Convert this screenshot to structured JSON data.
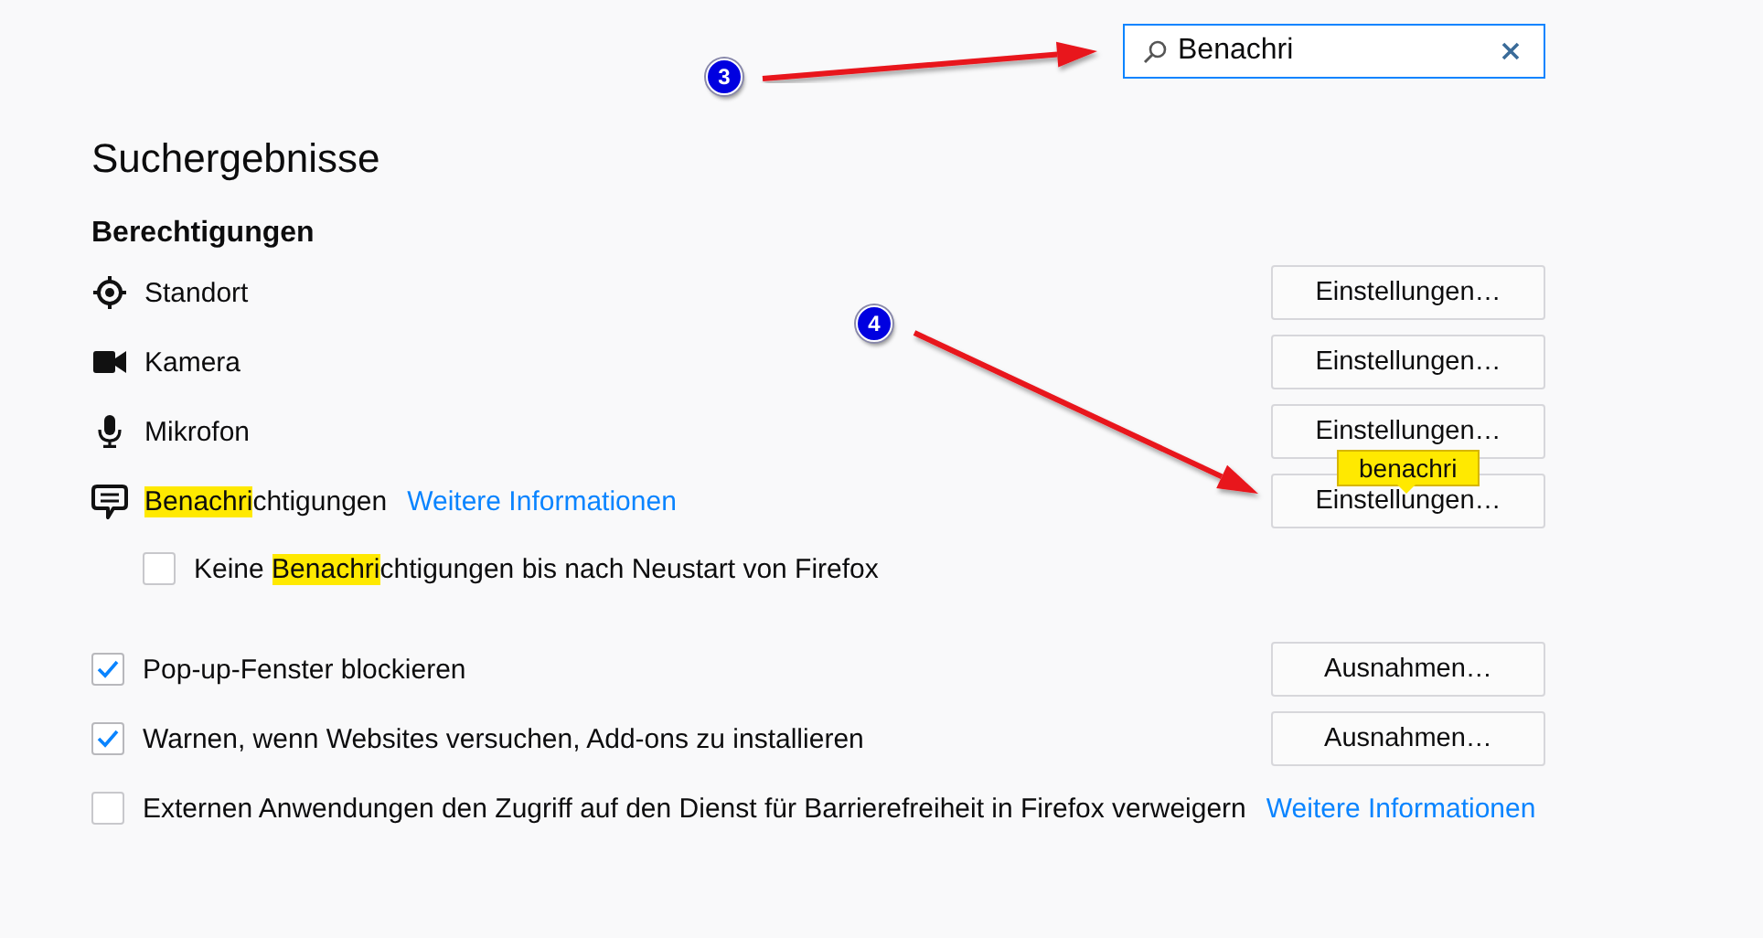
{
  "search": {
    "value": "Benachri"
  },
  "heading": "Suchergebnisse",
  "section": "Berechtigungen",
  "permissions": [
    {
      "kind": "location",
      "label_parts": [
        {
          "text": "Standort",
          "highlighted": false
        }
      ],
      "button": "Einstellungen…"
    },
    {
      "kind": "camera",
      "label_parts": [
        {
          "text": "Kamera",
          "highlighted": false
        }
      ],
      "button": "Einstellungen…"
    },
    {
      "kind": "microphone",
      "label_parts": [
        {
          "text": "Mikrofon",
          "highlighted": false
        }
      ],
      "button": "Einstellungen…"
    },
    {
      "kind": "notifications",
      "label_parts": [
        {
          "text": "Benachri",
          "highlighted": true
        },
        {
          "text": "chtigungen",
          "highlighted": false
        }
      ],
      "link": "Weitere Informationen",
      "button": "Einstellungen…",
      "tooltip": "benachri",
      "option": {
        "checked": false,
        "label_parts": [
          {
            "text": "Keine ",
            "highlighted": false
          },
          {
            "text": "Benachri",
            "highlighted": true
          },
          {
            "text": "chtigungen bis nach Neustart von Firefox",
            "highlighted": false
          }
        ]
      }
    }
  ],
  "checkboxes": [
    {
      "label": "Pop-up-Fenster blockieren",
      "checked": true,
      "button": "Ausnahmen…"
    },
    {
      "label": "Warnen, wenn Websites versuchen, Add-ons zu installieren",
      "checked": true,
      "button": "Ausnahmen…"
    },
    {
      "label": "Externen Anwendungen den Zugriff auf den Dienst für Barrierefreiheit in Firefox verweigern",
      "checked": false,
      "link": "Weitere Informationen"
    }
  ],
  "annotations": [
    {
      "label": "3"
    },
    {
      "label": "4"
    }
  ]
}
